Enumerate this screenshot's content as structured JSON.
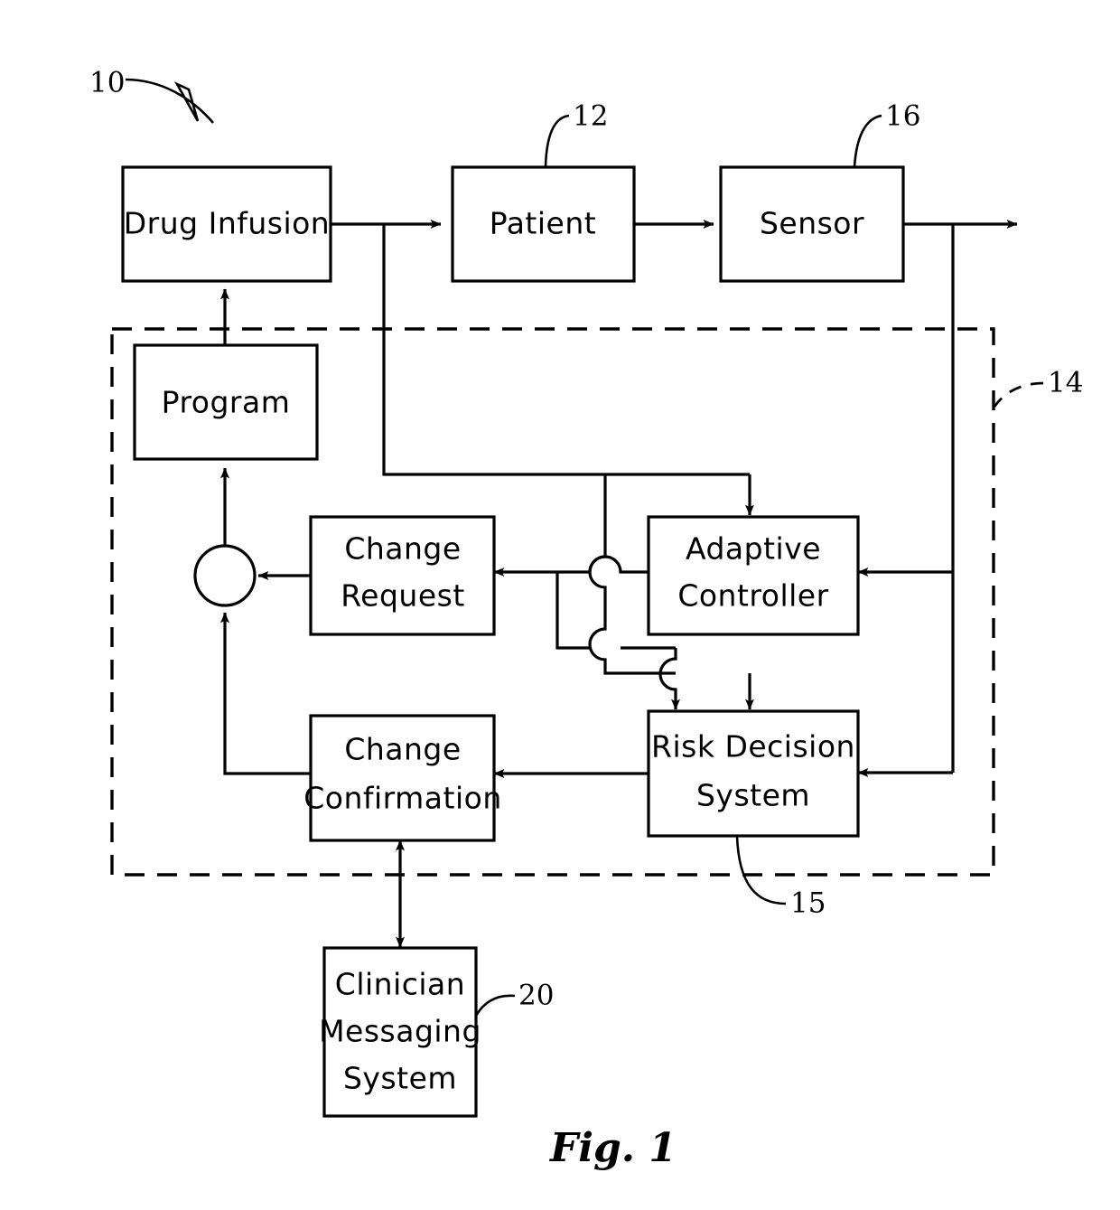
{
  "figure": {
    "caption": "Fig. 1",
    "title": "Closed-loop drug infusion control system block diagram"
  },
  "blocks": [
    {
      "id": "drug_infusion",
      "label": "Drug Infusion",
      "lines": [
        "Drug  Infusion"
      ]
    },
    {
      "id": "patient",
      "label": "Patient",
      "lines": [
        "Patient"
      ]
    },
    {
      "id": "sensor",
      "label": "Sensor",
      "lines": [
        "Sensor"
      ]
    },
    {
      "id": "program",
      "label": "Program",
      "lines": [
        "Program"
      ]
    },
    {
      "id": "change_request",
      "label": "Change Request",
      "lines": [
        "Change",
        "Request"
      ]
    },
    {
      "id": "adaptive_controller",
      "label": "Adaptive Controller",
      "lines": [
        "Adaptive",
        "Controller"
      ]
    },
    {
      "id": "change_confirmation",
      "label": "Change Confirmation",
      "lines": [
        "Change",
        "Confirmation"
      ]
    },
    {
      "id": "risk_decision",
      "label": "Risk Decision System",
      "lines": [
        "Risk  Decision",
        "System"
      ]
    },
    {
      "id": "clinician_messaging",
      "label": "Clinician Messaging System",
      "lines": [
        "Clinician",
        "Messaging",
        "System"
      ]
    }
  ],
  "reference_numerals": [
    {
      "id": "ref10",
      "value": "10",
      "points_to": "system-overall"
    },
    {
      "id": "ref12",
      "value": "12",
      "points_to": "patient"
    },
    {
      "id": "ref16",
      "value": "16",
      "points_to": "sensor"
    },
    {
      "id": "ref14",
      "value": "14",
      "points_to": "control-subsystem-boundary"
    },
    {
      "id": "ref15",
      "value": "15",
      "points_to": "risk_decision"
    },
    {
      "id": "ref20",
      "value": "20",
      "points_to": "clinician_messaging"
    }
  ],
  "colors": {
    "line": "#000000",
    "fill": "#ffffff",
    "background": "#ffffff"
  }
}
